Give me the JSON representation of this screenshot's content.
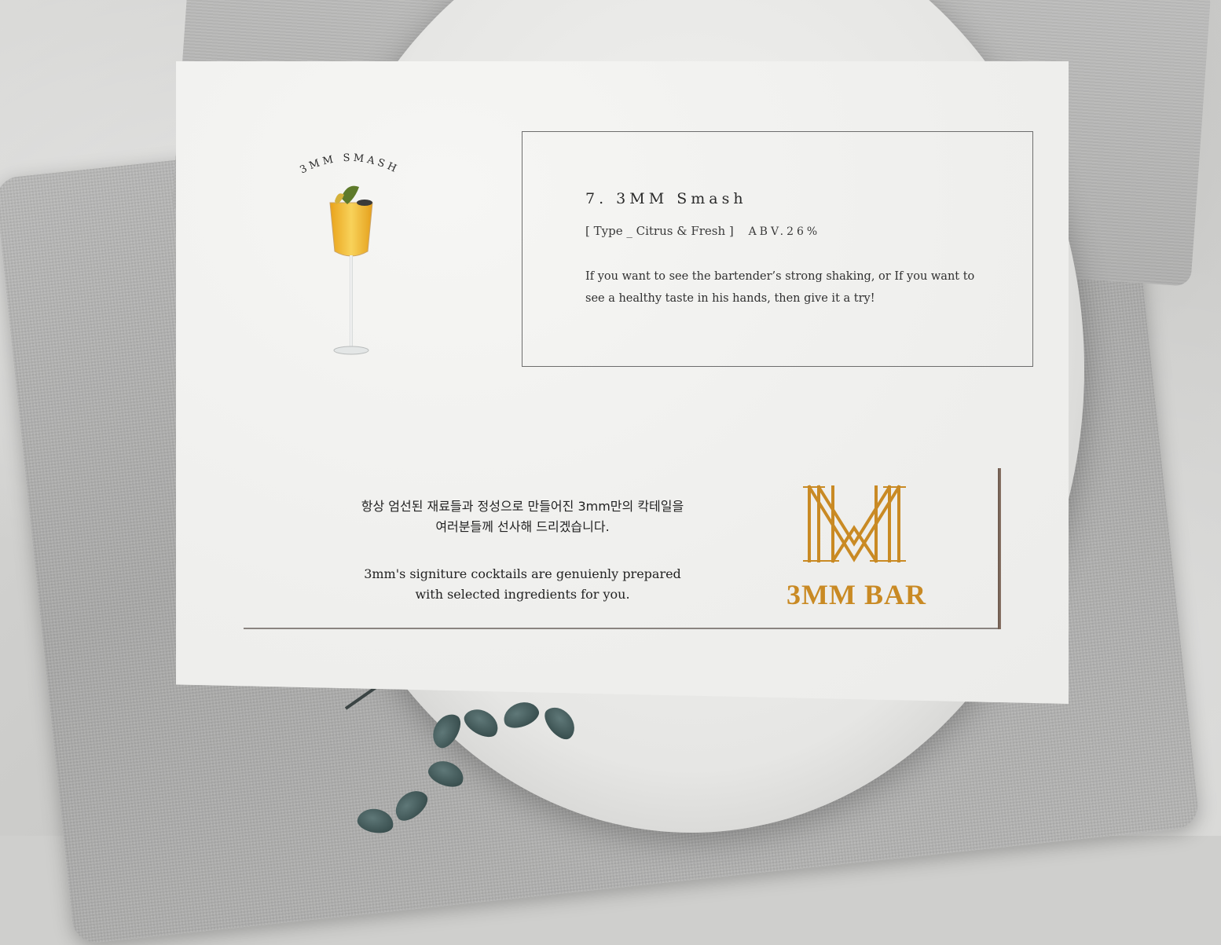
{
  "menu": {
    "arc_title": "3MM SMASH",
    "item_title": "7. 3MM Smash",
    "type_label": "[ Type _ Citrus & Fresh ]",
    "abv": "ABV.26%",
    "description": [
      "If you want to see the bartender’s strong shaking, or If you want to",
      "see a healthy taste in his hands, then give it a try!"
    ]
  },
  "footer": {
    "korean": [
      "항상 엄선된 재료들과 정성으로 만들어진 3mm만의 칵테일을",
      "여러분들께 선사해 드리겠습니다."
    ],
    "english": [
      "3mm's signiture cocktails are genuienly prepared",
      "with selected ingredients for you."
    ],
    "brand": "3MM BAR",
    "brand_color": "#c98a24"
  },
  "icons": {
    "drink": "champagne-flute-cocktail-icon",
    "logo": "3mm-monogram-logo"
  }
}
